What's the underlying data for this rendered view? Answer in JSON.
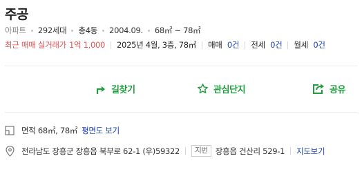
{
  "complex": {
    "name": "주공",
    "meta": {
      "type": "아파트",
      "households": "292세대",
      "buildings": "총4동",
      "built": "2004.09.",
      "area": "68㎡ ~ 78㎡"
    }
  },
  "trade": {
    "recent_label": "최근 매매 실거래가",
    "recent_price": "1억 1,000",
    "recent_detail": "2025년 4월, 3층, 78㎡",
    "sale_label": "매매",
    "sale_count": "0건",
    "jeonse_label": "전세",
    "jeonse_count": "0건",
    "monthly_label": "월세",
    "monthly_count": "0건"
  },
  "actions": {
    "directions": "길찾기",
    "favorite": "관심단지",
    "share": "공유"
  },
  "details": {
    "area_text": "면적 68㎡, 78㎡",
    "floorplan_link": "평면도 보기",
    "road_address": "전라남도 장흥군 장흥읍 북부로 62-1 (우)59322",
    "lot_badge": "지번",
    "lot_address": "장흥읍 건산리 529-1",
    "map_link": "지도보기"
  },
  "colors": {
    "accent_green": "#1e9e3e",
    "price_red": "#e35050",
    "link_blue": "#1a3fb0"
  },
  "icons": {
    "directions": "arrow-turn-icon",
    "favorite": "star-outline-icon",
    "share": "share-box-icon",
    "area": "floorplan-icon",
    "address": "map-pin-icon"
  }
}
